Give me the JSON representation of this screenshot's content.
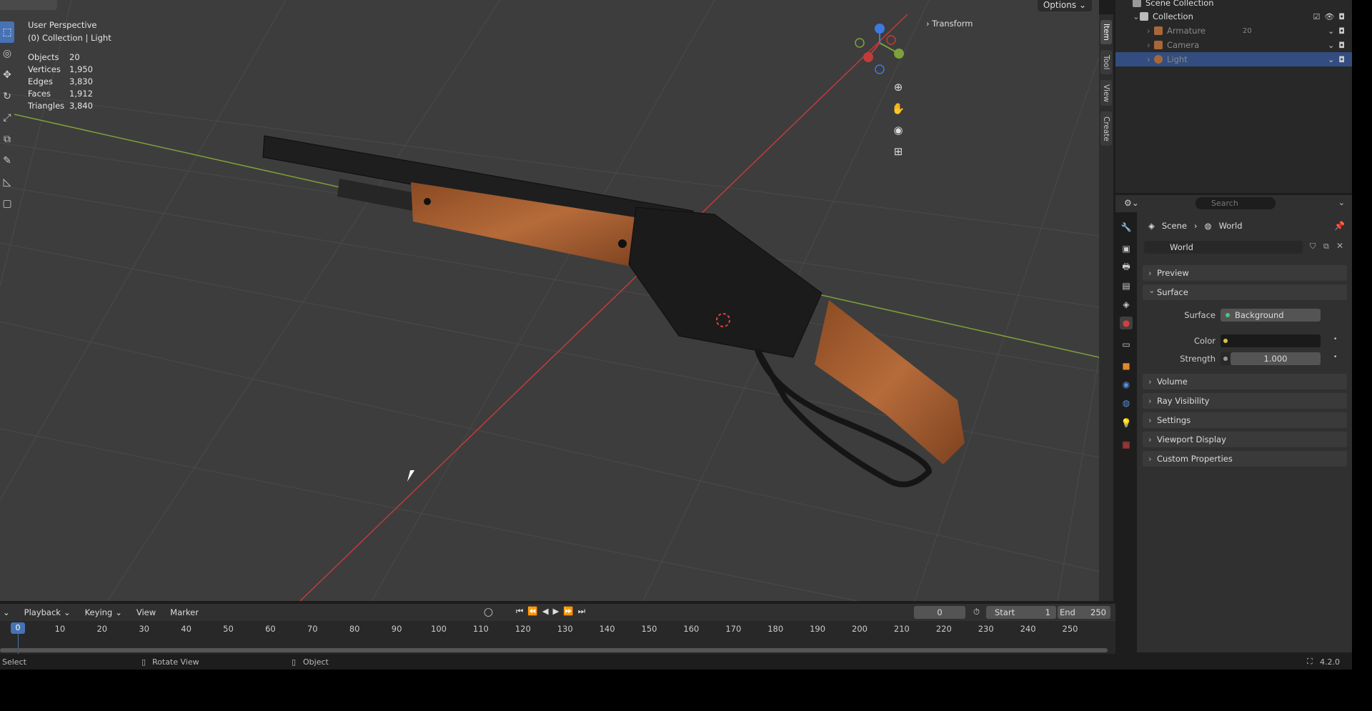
{
  "viewport": {
    "options_label": "Options",
    "perspective": "User Perspective",
    "context": "(0) Collection | Light",
    "stats": [
      {
        "label": "Objects",
        "value": "20"
      },
      {
        "label": "Vertices",
        "value": "1,950"
      },
      {
        "label": "Edges",
        "value": "3,830"
      },
      {
        "label": "Faces",
        "value": "1,912"
      },
      {
        "label": "Triangles",
        "value": "3,840"
      }
    ],
    "transform_label": "Transform",
    "gizmo": {
      "x": "X",
      "y": "Y",
      "z": "Z"
    },
    "side_tabs": [
      "Item",
      "Tool",
      "View",
      "Create"
    ],
    "tools": [
      "select-tool-icon",
      "cursor-icon",
      "move-icon",
      "rotate-icon",
      "scale-icon",
      "transform-icon",
      "annotate-icon",
      "measure-icon",
      "add-cube-icon"
    ]
  },
  "outliner": {
    "root": "Scene Collection",
    "collection": "Collection",
    "items": [
      {
        "name": "Armature",
        "count": "20"
      },
      {
        "name": "Camera",
        "count": ""
      },
      {
        "name": "Light",
        "count": ""
      }
    ]
  },
  "properties": {
    "search_placeholder": "Search",
    "breadcrumb_scene": "Scene",
    "breadcrumb_world": "World",
    "world_name": "World",
    "panels": {
      "preview": "Preview",
      "surface": "Surface",
      "volume": "Volume",
      "ray_visibility": "Ray Visibility",
      "settings": "Settings",
      "viewport_display": "Viewport Display",
      "custom_properties": "Custom Properties"
    },
    "surface_label": "Surface",
    "surface_value": "Background",
    "color_label": "Color",
    "strength_label": "Strength",
    "strength_value": "1.000"
  },
  "timeline": {
    "menus": [
      "Playback",
      "Keying",
      "View",
      "Marker"
    ],
    "current_frame": "0",
    "start_label": "Start",
    "start_value": "1",
    "end_label": "End",
    "end_value": "250",
    "playhead": "0",
    "ticks": [
      "10",
      "20",
      "30",
      "40",
      "50",
      "60",
      "70",
      "80",
      "90",
      "100",
      "110",
      "120",
      "130",
      "140",
      "150",
      "160",
      "170",
      "180",
      "190",
      "200",
      "210",
      "220",
      "230",
      "240",
      "250"
    ]
  },
  "statusbar": {
    "select": "Select",
    "rotate": "Rotate View",
    "object": "Object",
    "version": "4.2.0"
  },
  "colors": {
    "accent": "#4772b3",
    "x_axis": "#c23b3b",
    "y_axis": "#7fa13a",
    "z_axis": "#3c7ae0",
    "wood": "#a35a2c"
  }
}
